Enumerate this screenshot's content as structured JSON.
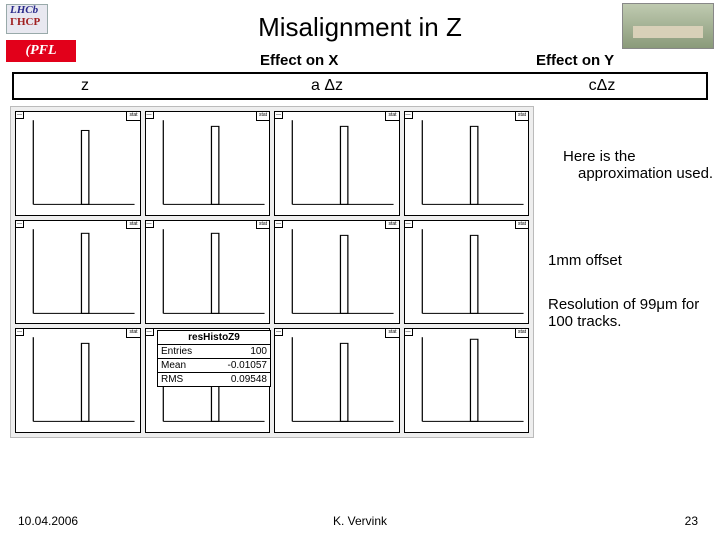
{
  "title": "Misalignment in Z",
  "logos": {
    "lhcb_top": "LHCb",
    "lhcb_bottom": "ГНСР",
    "epfl": "(PFL"
  },
  "headers": {
    "effect_x": "Effect on X",
    "effect_y": "Effect on Y"
  },
  "table": {
    "col1": "z",
    "col2": "a Δz",
    "col3": "cΔz"
  },
  "statbox": {
    "title": "resHistoZ9",
    "entries_label": "Entries",
    "entries_val": "100",
    "mean_label": "Mean",
    "mean_val": "-0.01057",
    "rms_label": "RMS",
    "rms_val": "0.09548"
  },
  "side": {
    "approx": "Here is the approximation used.",
    "offset": "1mm offset",
    "resolution": "Resolution of 99μm for 100 tracks."
  },
  "footer": {
    "date": "10.04.2006",
    "author": "K. Vervink",
    "page": "23"
  },
  "chart_data": [
    {
      "type": "bar",
      "xlim": [
        -6,
        6
      ],
      "ylim": [
        0,
        30
      ],
      "peak_x": 0,
      "peak_y": 28
    },
    {
      "type": "bar",
      "xlim": [
        -6,
        6
      ],
      "ylim": [
        0,
        60
      ],
      "peak_x": 0,
      "peak_y": 55
    },
    {
      "type": "bar",
      "xlim": [
        -6,
        6
      ],
      "ylim": [
        0,
        60
      ],
      "peak_x": 0,
      "peak_y": 55
    },
    {
      "type": "bar",
      "xlim": [
        -6,
        6
      ],
      "ylim": [
        0,
        60
      ],
      "peak_x": 0,
      "peak_y": 55
    },
    {
      "type": "bar",
      "xlim": [
        -6,
        6
      ],
      "ylim": [
        0,
        60
      ],
      "peak_x": 0,
      "peak_y": 58
    },
    {
      "type": "bar",
      "xlim": [
        -6,
        6
      ],
      "ylim": [
        0,
        70
      ],
      "peak_x": 0,
      "peak_y": 65
    },
    {
      "type": "bar",
      "xlim": [
        -6,
        6
      ],
      "ylim": [
        0,
        60
      ],
      "peak_x": 0,
      "peak_y": 55
    },
    {
      "type": "bar",
      "xlim": [
        -6,
        6
      ],
      "ylim": [
        0,
        60
      ],
      "peak_x": 0,
      "peak_y": 55
    },
    {
      "type": "bar",
      "xlim": [
        -6,
        6
      ],
      "ylim": [
        0,
        60
      ],
      "peak_x": 0,
      "peak_y": 55
    },
    {
      "type": "bar",
      "xlim": [
        -6,
        6
      ],
      "ylim": [
        0,
        35
      ],
      "peak_x": 0,
      "peak_y": 32
    },
    {
      "type": "bar",
      "xlim": [
        -6,
        6
      ],
      "ylim": [
        0,
        60
      ],
      "peak_x": 0,
      "peak_y": 55
    },
    {
      "type": "bar",
      "xlim": [
        -6,
        6
      ],
      "ylim": [
        0,
        70
      ],
      "peak_x": 0,
      "peak_y": 68
    }
  ]
}
